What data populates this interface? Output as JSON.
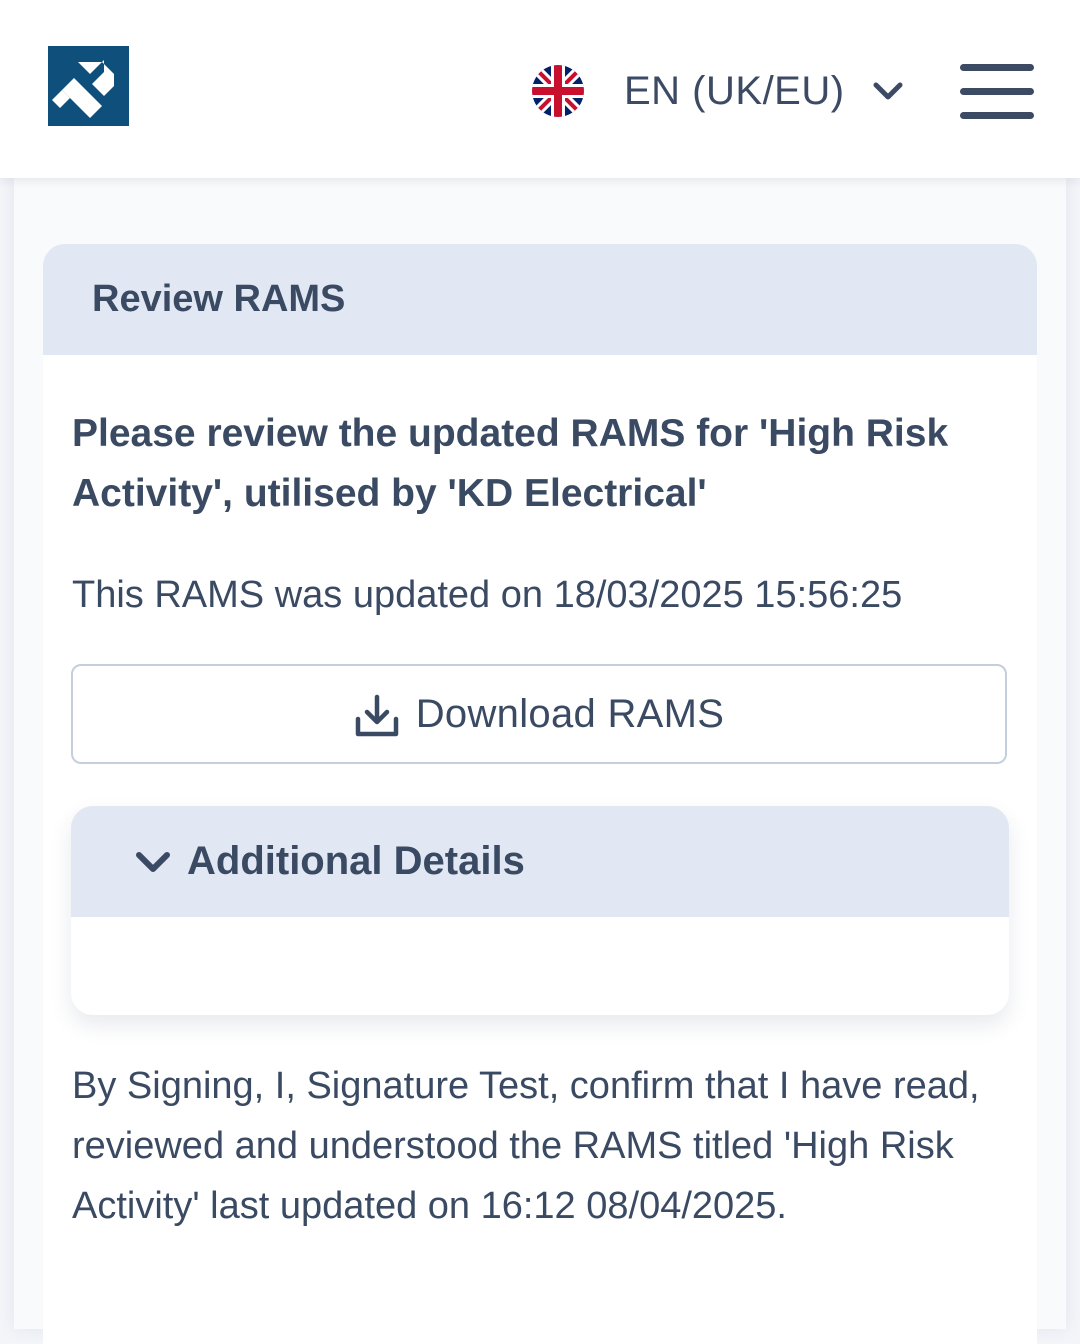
{
  "header": {
    "logo_alt": "Company logo",
    "language": {
      "flag_icon": "uk-flag-icon",
      "label": "EN (UK/EU)",
      "chevron_icon": "chevron-down-icon"
    },
    "menu_icon": "hamburger-menu-icon"
  },
  "card": {
    "title": "Review RAMS",
    "intro": "Please review the updated RAMS for 'High Risk Activity', utilised by 'KD Electrical'",
    "updated_text": "This RAMS was updated on 18/03/2025 15:56:25",
    "download_button": {
      "label": "Download RAMS",
      "icon": "download-icon"
    },
    "additional_details": {
      "title": "Additional Details",
      "chevron_icon": "chevron-down-icon",
      "expanded": true
    },
    "statement": "By Signing, I, Signature Test, confirm that I have read, reviewed and understood the RAMS titled 'High Risk Activity' last updated on 16:12 08/04/2025."
  },
  "colors": {
    "brand": "#0f4f7c",
    "text": "#3a4a63",
    "header_band": "#e1e7f3",
    "border": "#c5cedc"
  }
}
